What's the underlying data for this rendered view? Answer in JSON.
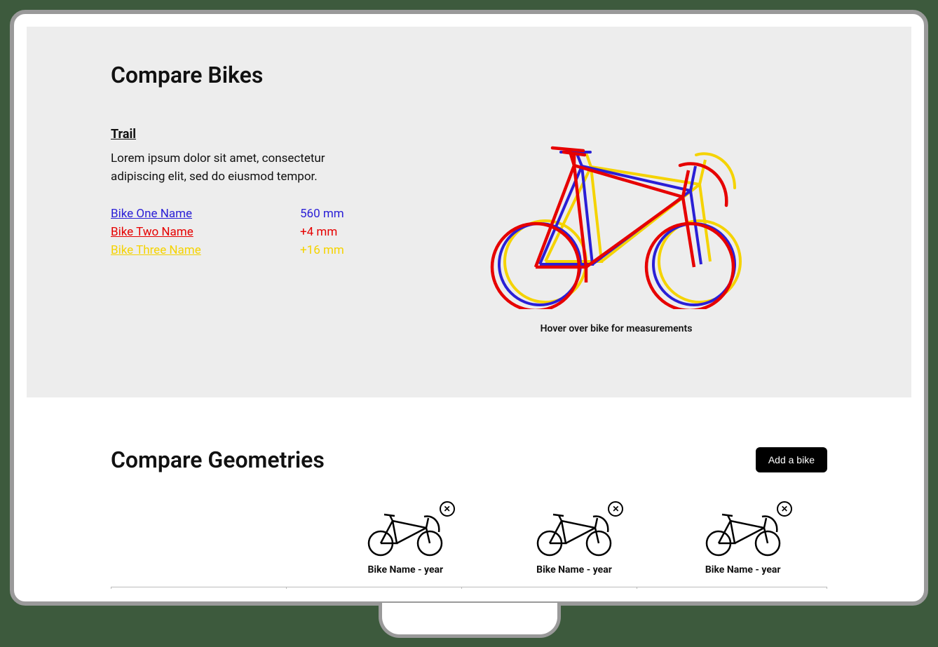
{
  "top": {
    "heading": "Compare Bikes",
    "metric_title": "Trail",
    "metric_desc": "Lorem ipsum dolor sit amet, consectetur adipiscing elit, sed do eiusmod tempor.",
    "hover_hint": "Hover over bike for measurements",
    "bikes": [
      {
        "name": "Bike One Name",
        "value": "560 mm",
        "color": "#2a1fd6"
      },
      {
        "name": "Bike Two Name",
        "value": "+4 mm",
        "color": "#e60000"
      },
      {
        "name": "Bike Three Name",
        "value": "+16 mm",
        "color": "#f5d300"
      }
    ]
  },
  "bottom": {
    "heading": "Compare Geometries",
    "add_label": "Add a bike",
    "cards": [
      {
        "label": "Bike Name - year"
      },
      {
        "label": "Bike Name - year"
      },
      {
        "label": "Bike Name - year"
      }
    ]
  },
  "colors": {
    "accent_blue": "#2a1fd6",
    "accent_red": "#e60000",
    "accent_yellow": "#f5d300"
  }
}
